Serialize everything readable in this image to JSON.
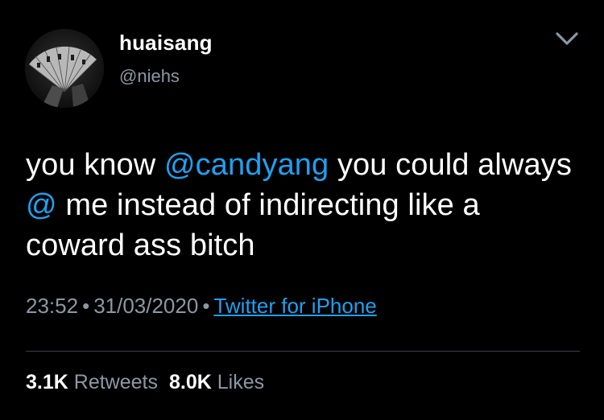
{
  "user": {
    "display_name": "huaisang",
    "handle": "@niehs",
    "avatar_icon": "avatar-fan-image"
  },
  "menu_icon": "chevron-down-icon",
  "tweet": {
    "text_1": "you know ",
    "mention_1": "@candyang",
    "text_2": " you could always ",
    "mention_2": "@",
    "text_3": " me instead of indirecting like a coward ass bitch"
  },
  "meta": {
    "time": "23:52",
    "separator": "•",
    "date": "31/03/2020",
    "source": "Twitter for iPhone"
  },
  "stats": {
    "retweets_count": "3.1K",
    "retweets_label": "Retweets",
    "likes_count": "8.0K",
    "likes_label": "Likes"
  },
  "colors": {
    "background": "#000000",
    "link": "#1da1f2",
    "secondary_text": "#8b98a5",
    "divider": "#3a3f45"
  }
}
